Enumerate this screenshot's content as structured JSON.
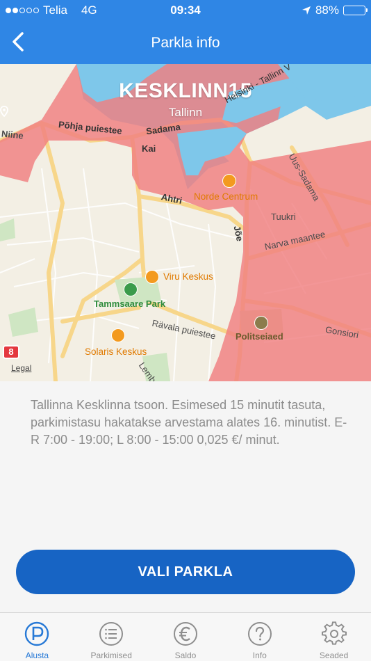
{
  "status_bar": {
    "carrier": "Telia",
    "network": "4G",
    "time": "09:34",
    "battery": "88%",
    "battery_level": 0.88,
    "signal_bars": 2
  },
  "nav": {
    "title": "Parkla info",
    "back_icon": "chevron-left-icon"
  },
  "parking": {
    "name": "KESKLINN15",
    "city": "Tallinn",
    "location_icon": "location-pin-icon"
  },
  "map": {
    "labels": {
      "niine": "Niine",
      "pohja": "Põhja puiestee",
      "sadama": "Sadama",
      "kai": "Kai",
      "helsinki": "Helsinki - Tallinn V",
      "uus_sadama": "Uus-Sadama",
      "ahtri": "Ahtri",
      "tuukri": "Tuukri",
      "joe": "Jõe",
      "narva": "Narva maantee",
      "ravala": "Rävala puiestee",
      "gonsiori": "Gonsiori",
      "lemb": "Lemb"
    },
    "pois": {
      "norde": "Norde Centrum",
      "viru": "Viru Keskus",
      "tammsaare": "Tammsaare Park",
      "solaris": "Solaris Keskus",
      "politseiaed": "Politseiaed"
    },
    "route_badge": "8",
    "legal": "Legal",
    "colors": {
      "zone": "#f28b8b",
      "water": "#7ec7ea",
      "land": "#f3efe4",
      "road": "#f7d68a"
    }
  },
  "description": "Tallinna Kesklinna tsoon. Esimesed 15 minutit tasuta, parkimistasu hakatakse arvestama alates 16. minutist. E-R 7:00 - 19:00; L 8:00 - 15:00 0,025 €/  minut.",
  "cta": {
    "label": "VALI PARKLA",
    "color": "#1764c4"
  },
  "tabs": [
    {
      "label": "Alusta",
      "icon": "parking-icon",
      "active": true
    },
    {
      "label": "Parkimised",
      "icon": "list-icon",
      "active": false
    },
    {
      "label": "Saldo",
      "icon": "euro-icon",
      "active": false
    },
    {
      "label": "Info",
      "icon": "help-icon",
      "active": false
    },
    {
      "label": "Seaded",
      "icon": "gear-icon",
      "active": false
    }
  ],
  "accent_color": "#2f86e5"
}
